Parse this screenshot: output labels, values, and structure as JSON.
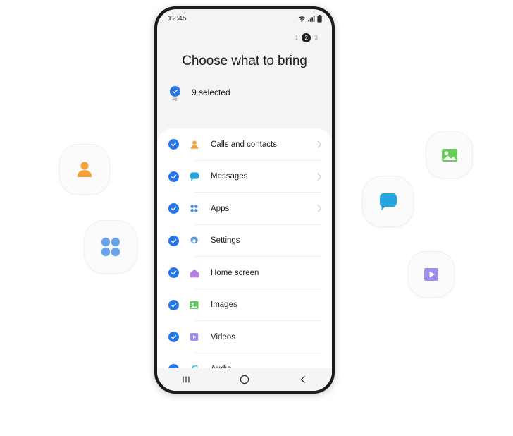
{
  "phone": {
    "status_bar": {
      "clock": "12:45",
      "icons": [
        "wifi-icon",
        "signal-icon",
        "battery-icon"
      ]
    },
    "steps": {
      "items": [
        "1",
        "2",
        "3"
      ],
      "active_index": 1,
      "active_label": "2",
      "first_label": "1",
      "last_label": "3"
    },
    "title": "Choose what to bring",
    "select_all": {
      "label": "All",
      "count_text": "9 selected",
      "checked": true
    },
    "list": [
      {
        "label": "Calls and contacts",
        "icon": "contacts-icon",
        "color": "#f6a23c",
        "checked": true,
        "chevron": true
      },
      {
        "label": "Messages",
        "icon": "messages-icon",
        "color": "#24a5e0",
        "checked": true,
        "chevron": true
      },
      {
        "label": "Apps",
        "icon": "apps-icon",
        "color": "#4a90e8",
        "checked": true,
        "chevron": true
      },
      {
        "label": "Settings",
        "icon": "settings-gear-icon",
        "color": "#5b9be0",
        "checked": true,
        "chevron": false
      },
      {
        "label": "Home screen",
        "icon": "home-screen-icon",
        "color": "#b87fe0",
        "checked": true,
        "chevron": false
      },
      {
        "label": "Images",
        "icon": "images-icon",
        "color": "#5fc95f",
        "checked": true,
        "chevron": false
      },
      {
        "label": "Videos",
        "icon": "videos-icon",
        "color": "#9b8ef0",
        "checked": true,
        "chevron": false
      },
      {
        "label": "Audio",
        "icon": "audio-icon",
        "color": "#3bc7e0",
        "checked": true,
        "chevron": false
      }
    ],
    "nav_bar": {
      "recents_label": "recents-icon",
      "home_label": "home-icon",
      "back_label": "back-icon"
    }
  },
  "floating_icons": [
    {
      "name": "contacts-icon",
      "color": "#f6a23c"
    },
    {
      "name": "apps-icon",
      "color": "#6aa2e8"
    },
    {
      "name": "messages-icon",
      "color": "#24a5e0"
    },
    {
      "name": "images-icon",
      "color": "#6dcc5e"
    },
    {
      "name": "videos-icon",
      "color": "#9b8ef0"
    }
  ],
  "colors": {
    "checkbox_blue": "#2676e8",
    "screen_bg": "#f4f4f4",
    "card_bg": "#ffffff"
  }
}
